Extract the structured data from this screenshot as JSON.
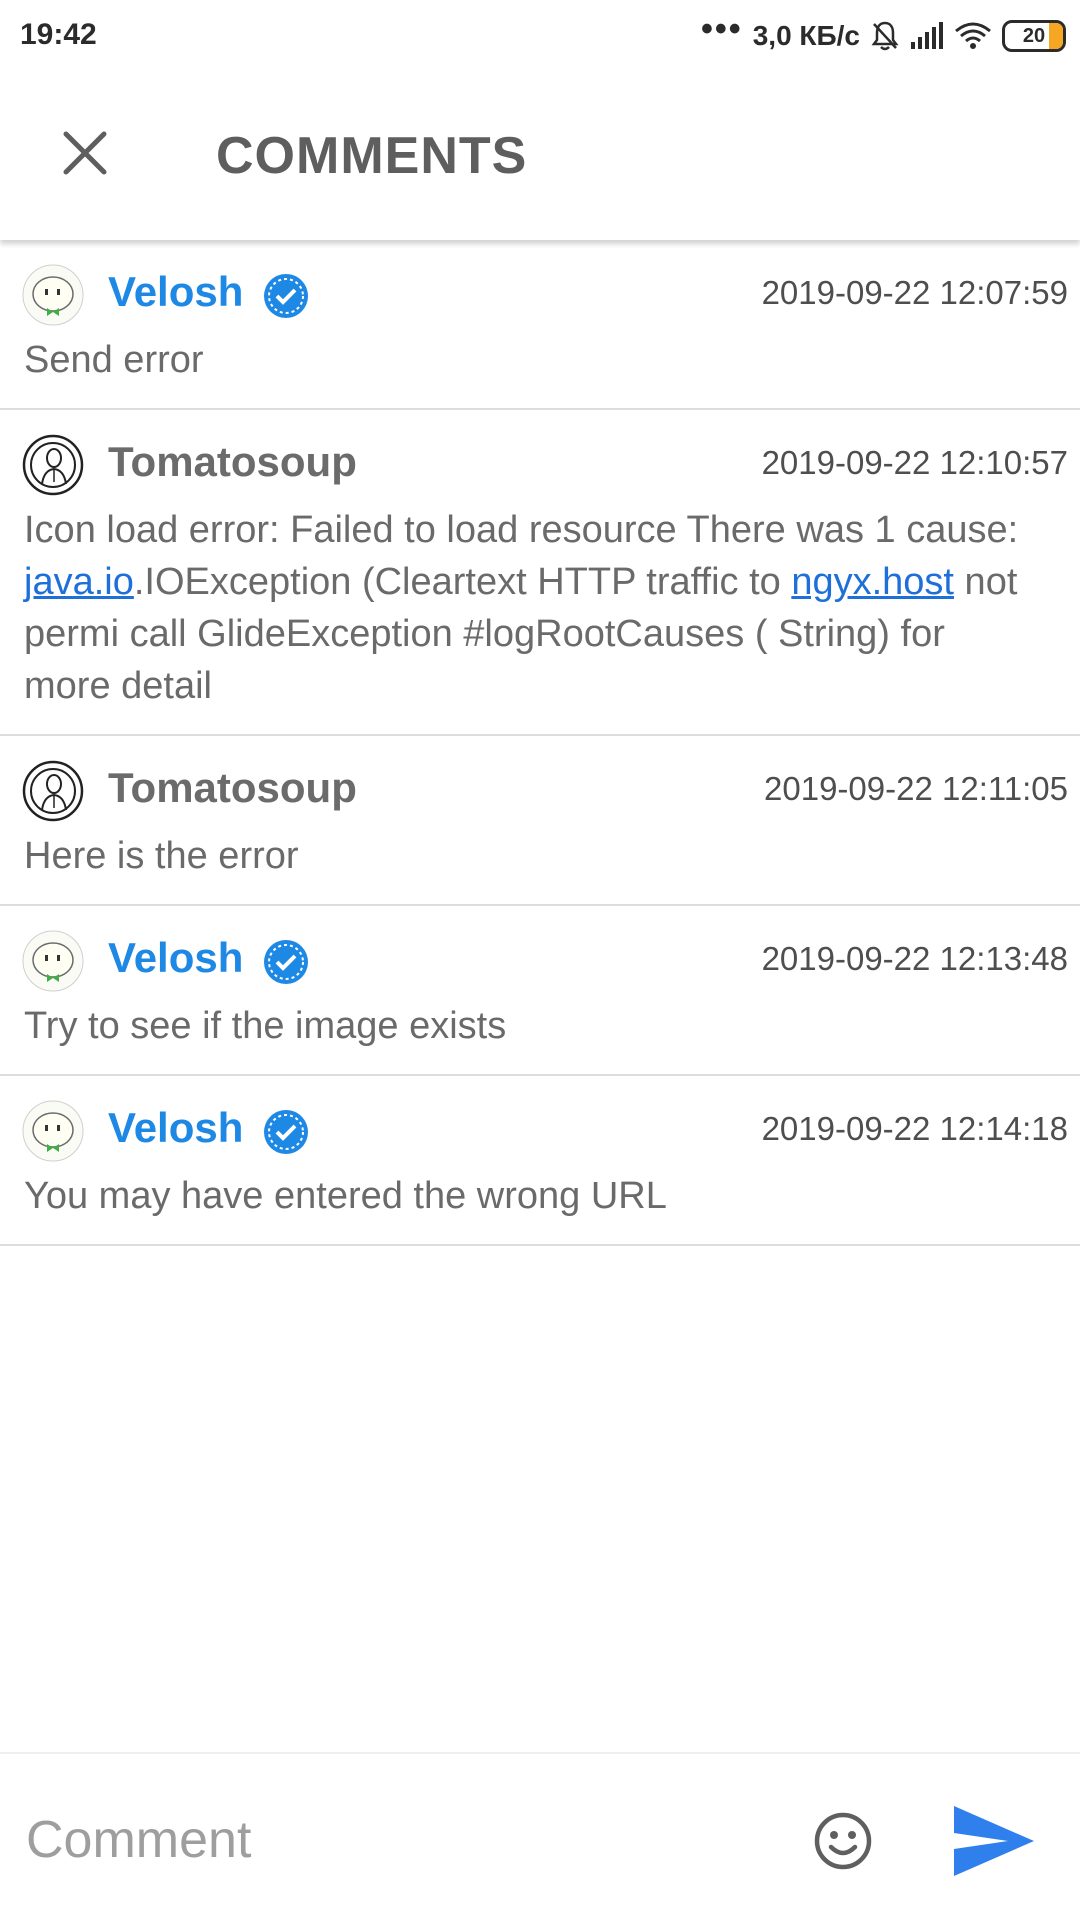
{
  "status_bar": {
    "time": "19:42",
    "dots": "•••",
    "speed": "3,0 КБ/с",
    "battery": "20"
  },
  "header": {
    "title": "COMMENTS",
    "close_icon": "close-icon"
  },
  "comments": [
    {
      "author": "Velosh",
      "verified": true,
      "timestamp": "2019-09-22 12:07:59",
      "text": "Send error"
    },
    {
      "author": "Tomatosoup",
      "verified": false,
      "timestamp": "2019-09-22 12:10:57",
      "text_parts": {
        "p1": "Icon load error: Failed to load resource There was 1 cause: ",
        "link1": "java.io",
        "p2": ".IOException (Cleartext HTTP traffic to ",
        "link2": "ngyx.host",
        "p3": " not permi call GlideException #logRootCauses (  String) for more detail"
      }
    },
    {
      "author": "Tomatosoup",
      "verified": false,
      "timestamp": "2019-09-22 12:11:05",
      "text": "Here is the error"
    },
    {
      "author": "Velosh",
      "verified": true,
      "timestamp": "2019-09-22 12:13:48",
      "text": "Try to see if the image exists"
    },
    {
      "author": "Velosh",
      "verified": true,
      "timestamp": "2019-09-22 12:14:18",
      "text": "You may have entered the wrong URL"
    }
  ],
  "composer": {
    "placeholder": "Comment",
    "emoji_icon": "emoji-smile-icon",
    "send_icon": "send-icon"
  },
  "colors": {
    "accent": "#1e88e5",
    "link": "#1e6fd9"
  }
}
